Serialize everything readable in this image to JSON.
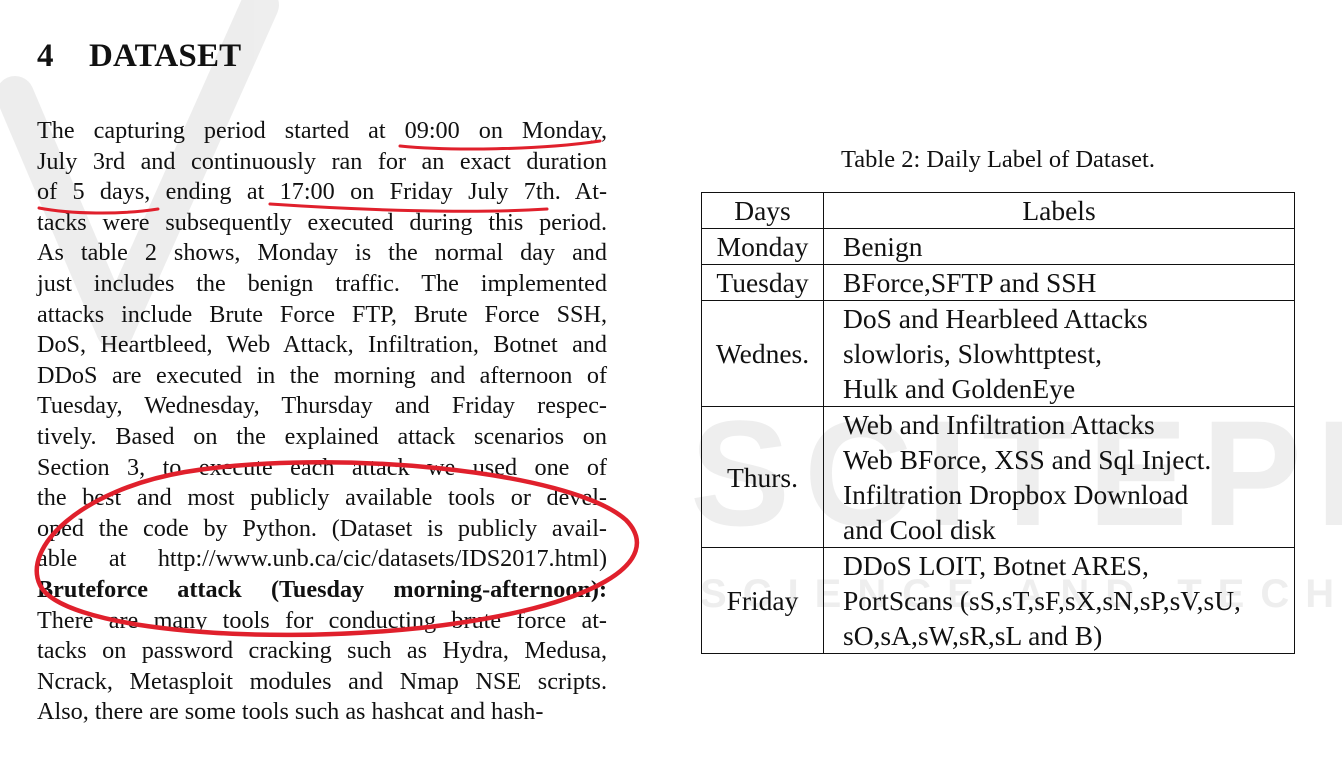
{
  "section": {
    "number": "4",
    "title": "DATASET"
  },
  "body_lines": [
    "The capturing period started at 09:00 on Monday,",
    "July 3rd and continuously ran for an exact duration",
    "of 5 days, ending at 17:00 on Friday July 7th. At-",
    "tacks were subsequently executed during this period.",
    "As table 2 shows, Monday is the normal day and",
    "just includes the benign traffic. The implemented",
    "attacks include Brute Force FTP, Brute Force SSH,",
    "DoS, Heartbleed, Web Attack, Infiltration, Botnet and",
    "DDoS are executed in the morning and afternoon of",
    "Tuesday, Wednesday, Thursday and Friday respec-",
    "tively. Based on the explained attack scenarios on",
    "Section 3, to execute each attack we used one of",
    "the best and most publicly available tools or devel-",
    "oped the code by Python. (Dataset is publicly avail-",
    "able at http://www.unb.ca/cic/datasets/IDS2017.html)",
    "Bruteforce attack (Tuesday morning-afternoon):",
    "There are many tools for conducting brute force at-",
    "tacks on password cracking such as Hydra, Medusa,",
    "Ncrack, Metasploit modules and Nmap NSE scripts.",
    "Also, there are some tools such as hashcat and hash-"
  ],
  "table": {
    "caption": "Table 2: Daily Label of Dataset.",
    "headers": [
      "Days",
      "Labels"
    ],
    "rows": [
      {
        "day": "Monday",
        "labels": [
          "Benign"
        ]
      },
      {
        "day": "Tuesday",
        "labels": [
          "BForce,SFTP and SSH"
        ]
      },
      {
        "day": "Wednes.",
        "labels": [
          "DoS and Hearbleed Attacks",
          "slowloris, Slowhttptest,",
          "Hulk and GoldenEye"
        ]
      },
      {
        "day": "Thurs.",
        "labels": [
          "Web and Infiltration Attacks",
          "Web BForce, XSS and Sql Inject.",
          "Infiltration Dropbox Download",
          "and Cool disk"
        ]
      },
      {
        "day": "Friday",
        "labels": [
          "DDoS LOIT, Botnet ARES,",
          "PortScans (sS,sT,sF,sX,sN,sP,sV,sU,",
          "sO,sA,sW,sR,sL and B)"
        ]
      }
    ]
  },
  "watermark": {
    "main": "SCITEPRESS",
    "sub": "SCIENCE AND TECHNOLOGY"
  },
  "colors": {
    "annotation": "#e0202c",
    "text": "#111111",
    "watermark": "#cfcfcf"
  }
}
